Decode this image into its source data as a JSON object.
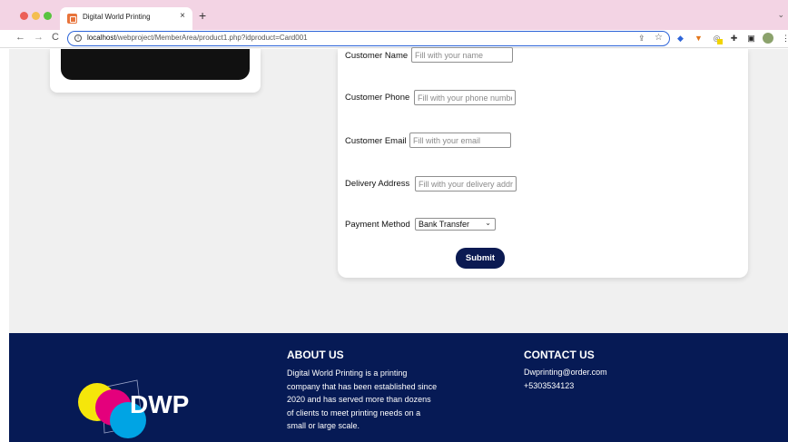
{
  "browser": {
    "tab_title": "Digital World Printing",
    "tab_close": "×",
    "new_tab": "+",
    "tab_menu": "⌄",
    "url_host": "localhost",
    "url_path": "/webproject/MemberArea/product1.php?idproduct=Card001"
  },
  "form": {
    "fields": [
      {
        "label": "Customer Name",
        "placeholder": "Fill with your name"
      },
      {
        "label": "Customer Phone",
        "placeholder": "Fill with your phone number"
      },
      {
        "label": "Customer Email",
        "placeholder": "Fill with your email"
      },
      {
        "label": "Delivery Address",
        "placeholder": "Fill with your delivery address"
      }
    ],
    "payment_label": "Payment Method",
    "payment_selected": "Bank Transfer",
    "submit_label": "Submit"
  },
  "footer": {
    "logo_text": "DWP",
    "about_title": "ABOUT US",
    "about_lines": [
      "Digital World Printing is a printing",
      "company that has been established since",
      "2020 and has served more than dozens",
      "of clients to meet printing needs on a",
      "small or large scale."
    ],
    "contact_title": "CONTACT US",
    "contact_email": "Dwprinting@order.com",
    "contact_phone": "+5303534123"
  },
  "colors": {
    "footer_bg": "#061a55",
    "submit_bg": "#0b1a52",
    "tabbar_bg": "#f3d4e4",
    "logo_yellow": "#f5e60a",
    "logo_magenta": "#e4007c",
    "logo_cyan": "#00a4e4"
  },
  "icons": [
    "back-icon",
    "forward-icon",
    "reload-icon",
    "info-icon",
    "share-icon",
    "star-icon",
    "extension-icon",
    "fox-icon",
    "puzzle-icon",
    "sidebar-icon",
    "avatar",
    "menu-icon"
  ]
}
